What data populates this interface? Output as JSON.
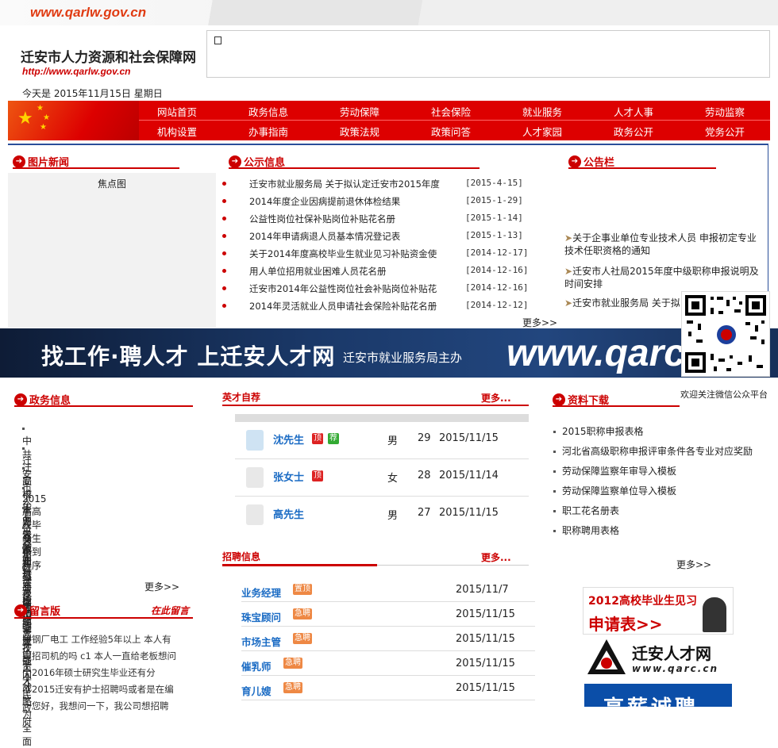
{
  "header": {
    "top_url": "www.qarlw.gov.cn",
    "site_name": "迁安市人力资源和社会保障网",
    "site_url": "http://www.qarlw.gov.cn",
    "date_text": "今天是  2015年11月15日  星期日"
  },
  "nav": {
    "row1": [
      "网站首页",
      "政务信息",
      "劳动保障",
      "社会保险",
      "就业服务",
      "人才人事",
      "劳动监察"
    ],
    "row2": [
      "机构设置",
      "办事指南",
      "政策法规",
      "政策问答",
      "人才家园",
      "政务公开",
      "党务公开"
    ]
  },
  "photo_news": {
    "title": "图片新闻",
    "placeholder": "焦点图"
  },
  "public_info": {
    "title": "公示信息",
    "more": "更多>>",
    "items": [
      {
        "text": "迁安市就业服务局 关于拟认定迁安市2015年度",
        "date": "[2015-4-15]"
      },
      {
        "text": "2014年度企业因病提前退休体检结果",
        "date": "[2015-1-29]"
      },
      {
        "text": "公益性岗位社保补贴岗位补贴花名册",
        "date": "[2015-1-14]"
      },
      {
        "text": "2014年申请病退人员基本情况登记表",
        "date": "[2015-1-13]"
      },
      {
        "text": "关于2014年度高校毕业生就业见习补贴资金使",
        "date": "[2014-12-17]"
      },
      {
        "text": "用人单位招用就业困难人员花名册",
        "date": "[2014-12-16]"
      },
      {
        "text": "迁安市2014年公益性岗位社会补贴岗位补贴花",
        "date": "[2014-12-16]"
      },
      {
        "text": "2014年灵活就业人员申请社会保险补贴花名册",
        "date": "[2014-12-12]"
      }
    ]
  },
  "announce": {
    "title": "公告栏",
    "items": [
      "关于企事业单位专业技术人员 申报初定专业技术任职资格的通知",
      "迁安市人社局2015年度中级职称申报说明及时间安排",
      "迁安市就业服务局 关于拟"
    ]
  },
  "banner": {
    "slogan": "找工作·聘人才  上迁安人才网",
    "sub": "迁安市就业服务局主办",
    "url": "www.qarc"
  },
  "qr": {
    "caption": "欢迎关注微信公众平台"
  },
  "gov_info": {
    "title": "政务信息",
    "more": "更多>>",
    "items": [
      "中共迁安市人力资源和社会保",
      "迁安市人力资源和社会保障局",
      "高校毕业生就业见习岗位需求",
      "2015届高校毕业生报到程序",
      "中央关于进一步加强党管人才",
      "关于进一步加强高技能人才工",
      "中共唐山市委 唐山市人民政府",
      "深入实施人才强国战略 为全面"
    ]
  },
  "message": {
    "title": "留言版",
    "link": "在此留言",
    "text": "钢厂电工 工作经验5年以上 本人有招司机的吗 c1 本人一直给老板想问2016年硕士研究生毕业还有分2015迁安有护士招聘吗或者是在编您好，我想问一下，我公司想招聘"
  },
  "talent": {
    "title": "英才自荐",
    "more": "更多...",
    "rows": [
      {
        "name": "沈先生",
        "badges": [
          "顶",
          "荐"
        ],
        "gender": "男",
        "age": "29",
        "date": "2015/11/15"
      },
      {
        "name": "张女士",
        "badges": [
          "顶"
        ],
        "gender": "女",
        "age": "28",
        "date": "2015/11/14"
      },
      {
        "name": "高先生",
        "badges": [],
        "gender": "男",
        "age": "27",
        "date": "2015/11/15"
      }
    ]
  },
  "jobs": {
    "title": "招聘信息",
    "more": "更多...",
    "rows": [
      {
        "name": "业务经理",
        "badge": "置顶",
        "date": "2015/11/7"
      },
      {
        "name": "珠宝顾问",
        "badge": "急聘",
        "date": "2015/11/15"
      },
      {
        "name": "市场主管",
        "badge": "急聘",
        "date": "2015/11/15"
      },
      {
        "name": "催乳师",
        "badge": "急聘",
        "date": "2015/11/15"
      },
      {
        "name": "育儿嫂",
        "badge": "急聘",
        "date": "2015/11/15"
      }
    ]
  },
  "downloads": {
    "title": "资料下载",
    "more": "更多>>",
    "items": [
      "2015职称申报表格",
      "河北省高级职称申报评审条件各专业对应奖励",
      "劳动保障监察年审导入模板",
      "劳动保障监察单位导入模板",
      "职工花名册表",
      "职称聘用表格"
    ]
  },
  "ads": {
    "ad1_line1": "2012高校毕业生见习",
    "ad1_line2": "申请表>>",
    "ad2_name": "迁安人才网",
    "ad2_url": "www.qarc.cn",
    "ad3": "高薪诚聘"
  },
  "colors": {
    "brand_red": "#d00000",
    "link_blue": "#1a6bc4",
    "banner_blue": "#1a3868"
  }
}
